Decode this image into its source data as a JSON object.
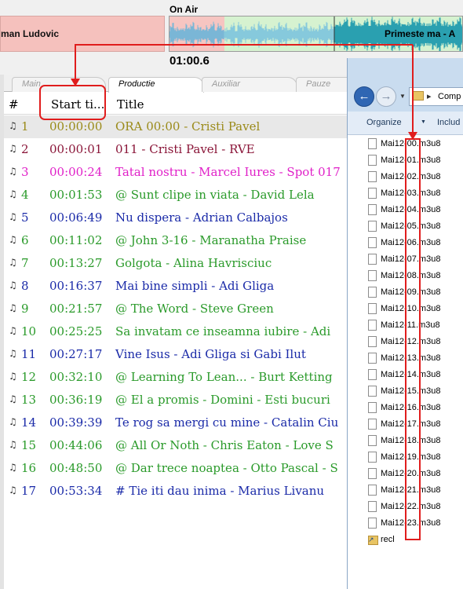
{
  "top": {
    "prev_track": "man Ludovic",
    "on_air_label": "On Air",
    "next_track": "Primeste ma - A",
    "time": "01:00.6"
  },
  "tabs": [
    {
      "label": "Main",
      "active": false
    },
    {
      "label": "Productie",
      "active": true
    },
    {
      "label": "Auxiliar",
      "active": false
    },
    {
      "label": "Pauze",
      "active": false
    }
  ],
  "columns": {
    "num": "#",
    "start": "Start ti...",
    "title": "Title"
  },
  "colors": {
    "olive": "#9a8a18",
    "maroon": "#8a1538",
    "magenta": "#e020c8",
    "green": "#2a9a2a",
    "blue": "#1a2aa8",
    "annotation_red": "#e01d1d"
  },
  "rows": [
    {
      "num": "1",
      "start": "00:00:00",
      "title": "ORA 00:00 - Cristi Pavel",
      "color": "olive",
      "selected": true
    },
    {
      "num": "2",
      "start": "00:00:01",
      "title": "011 - Cristi Pavel - RVE",
      "color": "maroon"
    },
    {
      "num": "3",
      "start": "00:00:24",
      "title": "Tatal nostru - Marcel Iures - Spot 017",
      "color": "magenta"
    },
    {
      "num": "4",
      "start": "00:01:53",
      "title": "@ Sunt clipe in viata - David Lela",
      "color": "green"
    },
    {
      "num": "5",
      "start": "00:06:49",
      "title": "Nu dispera - Adrian Calbajos",
      "color": "blue"
    },
    {
      "num": "6",
      "start": "00:11:02",
      "title": "@ John 3-16 - Maranatha Praise",
      "color": "green"
    },
    {
      "num": "7",
      "start": "00:13:27",
      "title": "Golgota - Alina Havrisciuc",
      "color": "green"
    },
    {
      "num": "8",
      "start": "00:16:37",
      "title": "Mai bine simpli - Adi Gliga",
      "color": "blue"
    },
    {
      "num": "9",
      "start": "00:21:57",
      "title": "@ The Word - Steve Green",
      "color": "green"
    },
    {
      "num": "10",
      "start": "00:25:25",
      "title": "Sa invatam ce inseamna iubire - Adi",
      "color": "green"
    },
    {
      "num": "11",
      "start": "00:27:17",
      "title": "Vine Isus - Adi Gliga si Gabi Ilut",
      "color": "blue"
    },
    {
      "num": "12",
      "start": "00:32:10",
      "title": "@  Learning To Lean... - Burt Ketting",
      "color": "green"
    },
    {
      "num": "13",
      "start": "00:36:19",
      "title": "@ El a promis - Domini - Esti bucuri",
      "color": "green"
    },
    {
      "num": "14",
      "start": "00:39:39",
      "title": "Te rog sa mergi cu mine - Catalin Ciu",
      "color": "blue"
    },
    {
      "num": "15",
      "start": "00:44:06",
      "title": "@ All Or Noth - Chris Eaton - Love S",
      "color": "green"
    },
    {
      "num": "16",
      "start": "00:48:50",
      "title": "@ Dar trece noaptea - Otto Pascal - S",
      "color": "green"
    },
    {
      "num": "17",
      "start": "00:53:34",
      "title": "# Tie iti dau inima - Marius Livanu",
      "color": "blue"
    }
  ],
  "explorer": {
    "address": "Comp",
    "toolbar": {
      "organize": "Organize",
      "include": "Includ"
    },
    "files": [
      "Mai12-00.m3u8",
      "Mai12-01.m3u8",
      "Mai12-02.m3u8",
      "Mai12-03.m3u8",
      "Mai12-04.m3u8",
      "Mai12-05.m3u8",
      "Mai12-06.m3u8",
      "Mai12-07.m3u8",
      "Mai12-08.m3u8",
      "Mai12-09.m3u8",
      "Mai12-10.m3u8",
      "Mai12-11.m3u8",
      "Mai12-12.m3u8",
      "Mai12-13.m3u8",
      "Mai12-14.m3u8",
      "Mai12-15.m3u8",
      "Mai12-16.m3u8",
      "Mai12-17.m3u8",
      "Mai12-18.m3u8",
      "Mai12-19.m3u8",
      "Mai12-20.m3u8",
      "Mai12-21.m3u8",
      "Mai12-22.m3u8",
      "Mai12-23.m3u8"
    ],
    "shortcut": "recl"
  }
}
